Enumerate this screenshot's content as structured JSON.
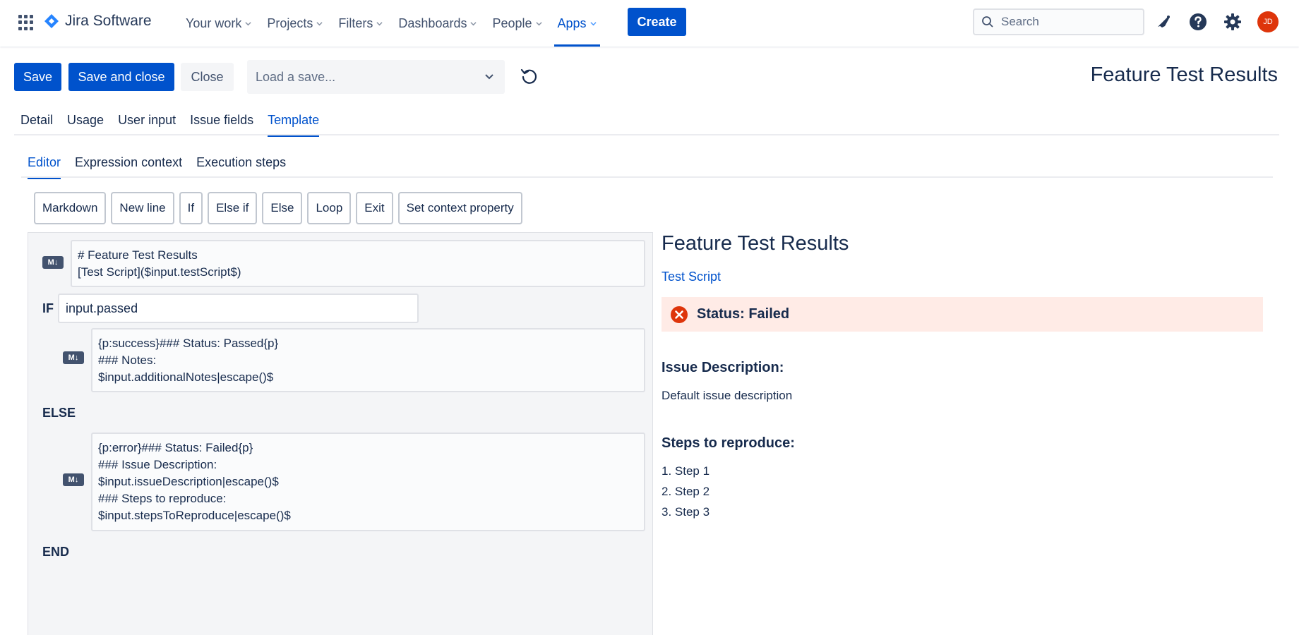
{
  "app": {
    "name": "Jira Software",
    "avatar_initials": "JD"
  },
  "nav": {
    "items": [
      "Your work",
      "Projects",
      "Filters",
      "Dashboards",
      "People",
      "Apps"
    ],
    "active": "Apps",
    "create_label": "Create",
    "search_placeholder": "Search"
  },
  "toolbar": {
    "save_label": "Save",
    "save_close_label": "Save and close",
    "close_label": "Close",
    "load_placeholder": "Load a save..."
  },
  "page_title": "Feature Test Results",
  "tabs": [
    "Detail",
    "Usage",
    "User input",
    "Issue fields",
    "Template"
  ],
  "active_tab": "Template",
  "subtabs": [
    "Editor",
    "Expression context",
    "Execution steps"
  ],
  "active_subtab": "Editor",
  "editor_buttons": [
    "Markdown",
    "New line",
    "If",
    "Else if",
    "Else",
    "Loop",
    "Exit",
    "Set context property"
  ],
  "editor": {
    "md_badge": "M↓",
    "block1": "# Feature Test Results\n[Test Script]($input.testScript$)",
    "if_keyword": "IF",
    "if_condition": "input.passed",
    "block2": "{p:success}### Status: Passed{p}\n### Notes:\n$input.additionalNotes|escape()$",
    "else_keyword": "ELSE",
    "block3": "{p:error}### Status: Failed{p}\n### Issue Description:\n$input.issueDescription|escape()$\n### Steps to reproduce:\n$input.stepsToReproduce|escape()$",
    "end_keyword": "END"
  },
  "preview": {
    "title": "Feature Test Results",
    "link": "Test Script",
    "status": "Status: Failed",
    "issue_heading": "Issue Description:",
    "issue_text": "Default issue description",
    "steps_heading": "Steps to reproduce:",
    "steps": [
      "1. Step 1",
      "2. Step 2",
      "3. Step 3"
    ]
  },
  "colors": {
    "primary": "#0052cc",
    "error_bg": "#ffebe6",
    "error_icon": "#de350b",
    "text": "#172b4d"
  }
}
